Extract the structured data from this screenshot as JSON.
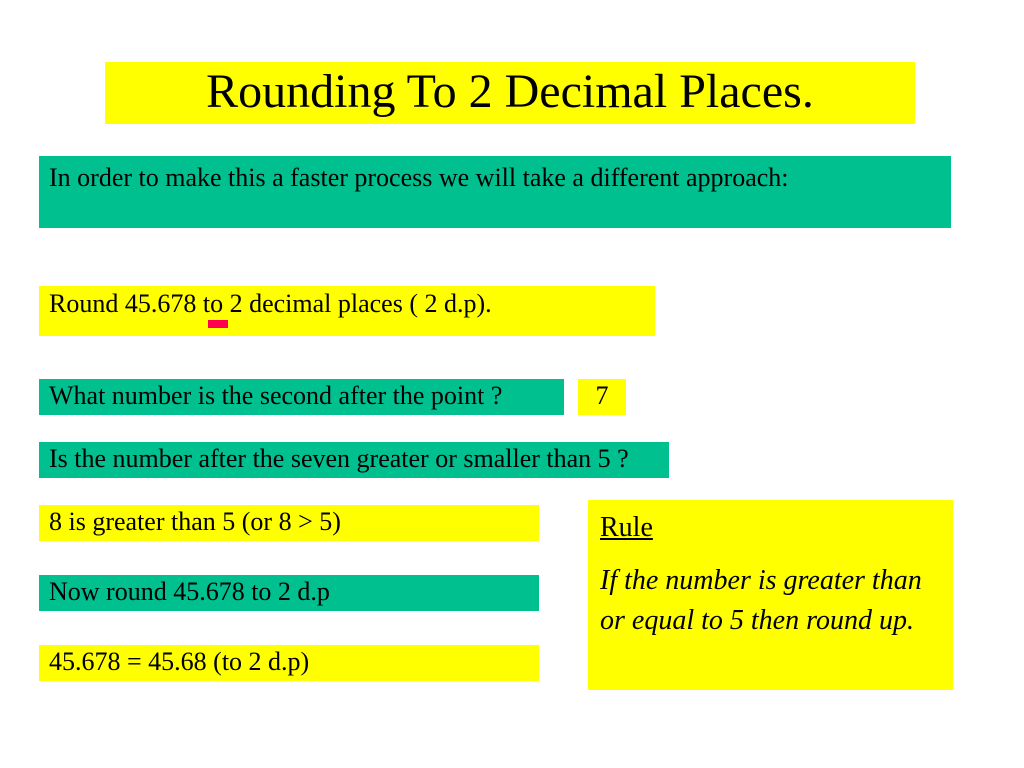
{
  "title": "Rounding To 2 Decimal Places.",
  "intro": "In order to make this a faster process we will take a different approach:",
  "question": "Round 45.678 to 2 decimal places ( 2 d.p).",
  "q1": "What number is the second after the point ?",
  "a1": "7",
  "q2": "Is the number after the seven greater or smaller than 5 ?",
  "a2": "8 is greater than 5 (or 8 > 5)",
  "q3": "Now round 45.678 to 2 d.p",
  "a3": "45.678 = 45.68 (to 2 d.p)",
  "rule": {
    "title": "Rule",
    "body": "If the number is greater than or equal to 5 then round up."
  }
}
